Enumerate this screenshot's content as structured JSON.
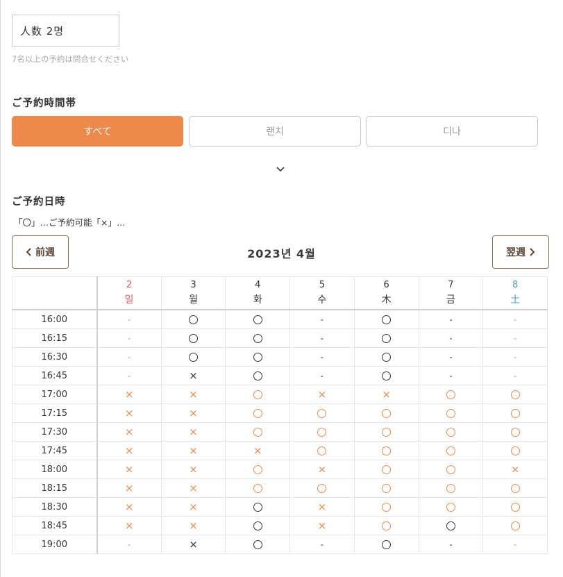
{
  "people": {
    "value": "人数 2명",
    "note": "7名以上の予約は問合せください"
  },
  "time_section": {
    "title": "ご予約時間帯",
    "tabs": [
      {
        "label": "すべて",
        "active": true
      },
      {
        "label": "랜치",
        "active": false
      },
      {
        "label": "디나",
        "active": false
      }
    ]
  },
  "date_section": {
    "title": "ご予約日時",
    "legend": "「〇」…ご予約可能「×」…",
    "prev_label": "前週",
    "next_label": "翌週",
    "month": "2023년 4월"
  },
  "calendar": {
    "days": [
      {
        "date": "2",
        "weekday": "일",
        "kind": "sun"
      },
      {
        "date": "3",
        "weekday": "월",
        "kind": ""
      },
      {
        "date": "4",
        "weekday": "화",
        "kind": ""
      },
      {
        "date": "5",
        "weekday": "수",
        "kind": ""
      },
      {
        "date": "6",
        "weekday": "木",
        "kind": ""
      },
      {
        "date": "7",
        "weekday": "금",
        "kind": ""
      },
      {
        "date": "8",
        "weekday": "土",
        "kind": "sat"
      }
    ],
    "legend_note": "k=black, o=orange; symbols: circle=○ cross=× dash=-",
    "rows": [
      {
        "time": "16:00",
        "slots": [
          "-o",
          "ck",
          "ck",
          "-k",
          "ck",
          "-k",
          "-o"
        ]
      },
      {
        "time": "16:15",
        "slots": [
          "-o",
          "ck",
          "ck",
          "-k",
          "ck",
          "-k",
          "-o"
        ]
      },
      {
        "time": "16:30",
        "slots": [
          "-o",
          "ck",
          "ck",
          "-k",
          "ck",
          "-k",
          "-o"
        ]
      },
      {
        "time": "16:45",
        "slots": [
          "-o",
          "xk",
          "ck",
          "-k",
          "ck",
          "-k",
          "-o"
        ]
      },
      {
        "time": "17:00",
        "slots": [
          "xo",
          "xo",
          "co",
          "xo",
          "xo",
          "co",
          "co"
        ]
      },
      {
        "time": "17:15",
        "slots": [
          "xo",
          "xo",
          "co",
          "co",
          "co",
          "co",
          "co"
        ]
      },
      {
        "time": "17:30",
        "slots": [
          "xo",
          "xo",
          "co",
          "co",
          "co",
          "co",
          "co"
        ]
      },
      {
        "time": "17:45",
        "slots": [
          "xo",
          "xo",
          "xo",
          "co",
          "co",
          "co",
          "co"
        ]
      },
      {
        "time": "18:00",
        "slots": [
          "xo",
          "xo",
          "co",
          "xo",
          "co",
          "co",
          "xo"
        ]
      },
      {
        "time": "18:15",
        "slots": [
          "xo",
          "xo",
          "co",
          "co",
          "co",
          "co",
          "co"
        ]
      },
      {
        "time": "18:30",
        "slots": [
          "xo",
          "xo",
          "ck",
          "xo",
          "co",
          "co",
          "co"
        ]
      },
      {
        "time": "18:45",
        "slots": [
          "xo",
          "xo",
          "ck",
          "xo",
          "co",
          "ck",
          "co"
        ]
      },
      {
        "time": "19:00",
        "slots": [
          "-o",
          "xk",
          "ck",
          "-k",
          "ck",
          "-k",
          "-o"
        ]
      }
    ]
  },
  "colors": {
    "accent": "#ed894b",
    "sunday": "#e2555b",
    "saturday": "#4a9bd6",
    "nav_border": "#8a6a4e"
  }
}
